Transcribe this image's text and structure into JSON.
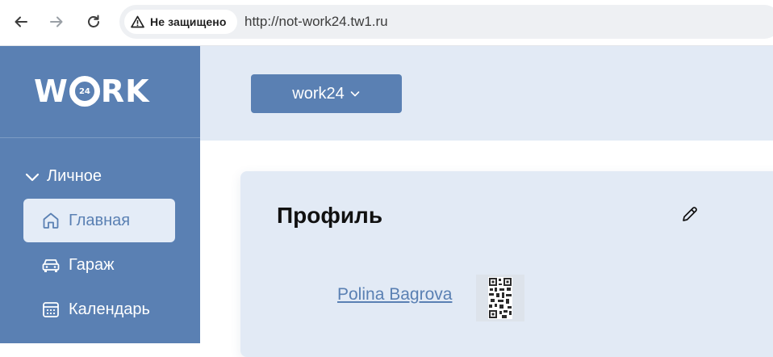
{
  "browser": {
    "back_icon": "arrow-left-icon",
    "forward_icon": "arrow-right-icon",
    "reload_icon": "reload-icon",
    "security_icon": "warning-triangle-icon",
    "security_label": "Не защищено",
    "url": "http://not-work24.tw1.ru"
  },
  "sidebar": {
    "logo": "WORK",
    "logo_badge": "24",
    "section": {
      "title": "Личное",
      "icon": "chevron-down-icon",
      "expanded": true
    },
    "items": [
      {
        "label": "Главная",
        "icon": "home-icon",
        "active": true
      },
      {
        "label": "Гараж",
        "icon": "car-icon",
        "active": false
      },
      {
        "label": "Календарь",
        "icon": "calendar-icon",
        "active": false
      }
    ]
  },
  "header": {
    "org_selector": {
      "label": "work24",
      "icon": "chevron-down-icon"
    }
  },
  "profile": {
    "title": "Профиль",
    "edit_icon": "pencil-icon",
    "user_name": "Polina Bagrova",
    "qr_icon": "qr-code-icon"
  },
  "colors": {
    "primary": "#5a80b3",
    "panel_bg": "#e2eaf5",
    "active_item_bg": "#e4ecf7",
    "text_dark": "#111111"
  }
}
